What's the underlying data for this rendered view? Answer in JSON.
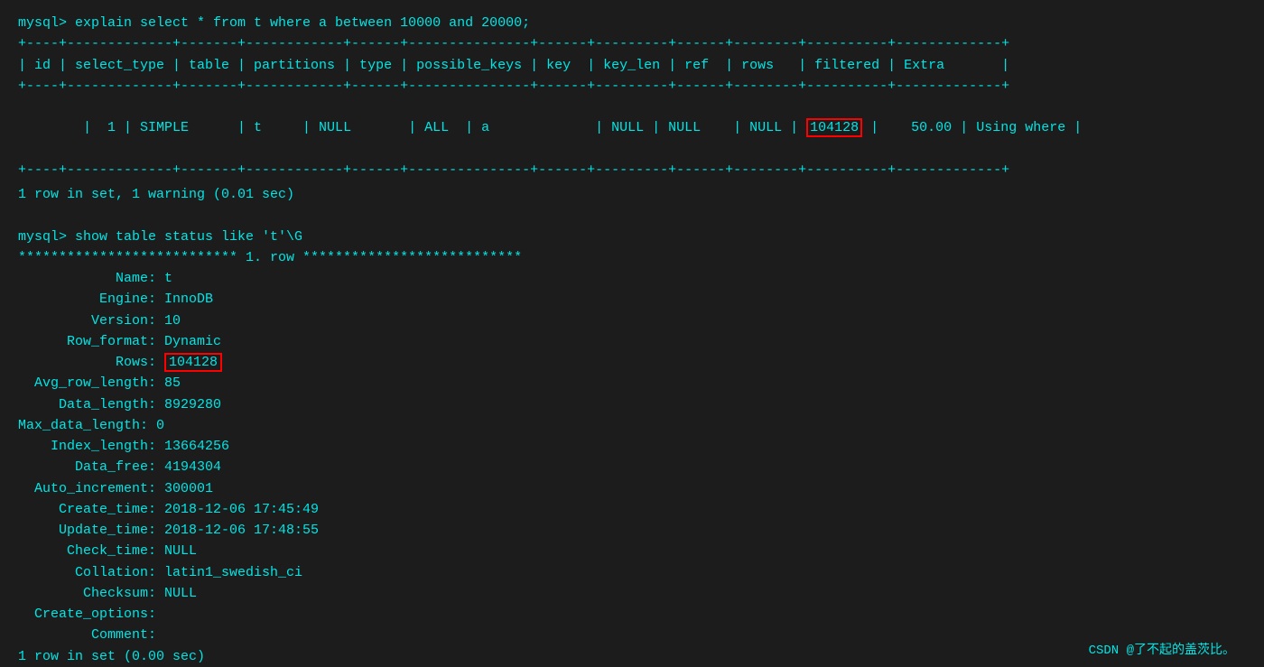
{
  "terminal": {
    "bg_color": "#1c1c1c",
    "text_color": "#00e5e5"
  },
  "command1": "mysql> explain select * from t where a between 10000 and 20000;",
  "table": {
    "separator_top": "+----+-------------+-------+------------+------+---------------+------+---------+------+--------+----------+-------------+",
    "header_row": "| id | select_type | table | partitions | type | possible_keys | key  | key_len | ref  | rows   | filtered | Extra       |",
    "separator_mid": "+----+-------------+-------+------------+------+---------------+------+---------+------+--------+----------+-------------+",
    "data_row": "|  1 | SIMPLE      | t     | NULL       | ALL  | a             | NULL | NULL    | NULL | 104128 |    50.00 | Using where |",
    "separator_bot": "+----+-------------+-------+------------+------+---------------+------+---------+------+--------+----------+-------------+"
  },
  "result1": "1 row in set, 1 warning (0.01 sec)",
  "blank1": "",
  "command2": "mysql> show table status like 't'\\G",
  "stars_row": "*************************** 1. row ***************************",
  "fields": [
    {
      "label": "            Name",
      "value": "t"
    },
    {
      "label": "          Engine",
      "value": "InnoDB"
    },
    {
      "label": "         Version",
      "value": "10"
    },
    {
      "label": "      Row_format",
      "value": "Dynamic"
    },
    {
      "label": "            Rows",
      "value": "104128",
      "highlight": true
    },
    {
      "label": "  Avg_row_length",
      "value": "85"
    },
    {
      "label": "     Data_length",
      "value": "8929280"
    },
    {
      "label": "Max_data_length",
      "value": "0"
    },
    {
      "label": "    Index_length",
      "value": "13664256"
    },
    {
      "label": "       Data_free",
      "value": "4194304"
    },
    {
      "label": "  Auto_increment",
      "value": "300001"
    },
    {
      "label": "     Create_time",
      "value": "2018-12-06 17:45:49"
    },
    {
      "label": "     Update_time",
      "value": "2018-12-06 17:48:55"
    },
    {
      "label": "      Check_time",
      "value": "NULL"
    },
    {
      "label": "       Collation",
      "value": "latin1_swedish_ci"
    },
    {
      "label": "        Checksum",
      "value": "NULL"
    },
    {
      "label": "  Create_options",
      "value": ""
    },
    {
      "label": "         Comment",
      "value": ""
    }
  ],
  "result2": "1 row in set (0.00 sec)",
  "watermark": "CSDN @了不起的盖茨比。"
}
